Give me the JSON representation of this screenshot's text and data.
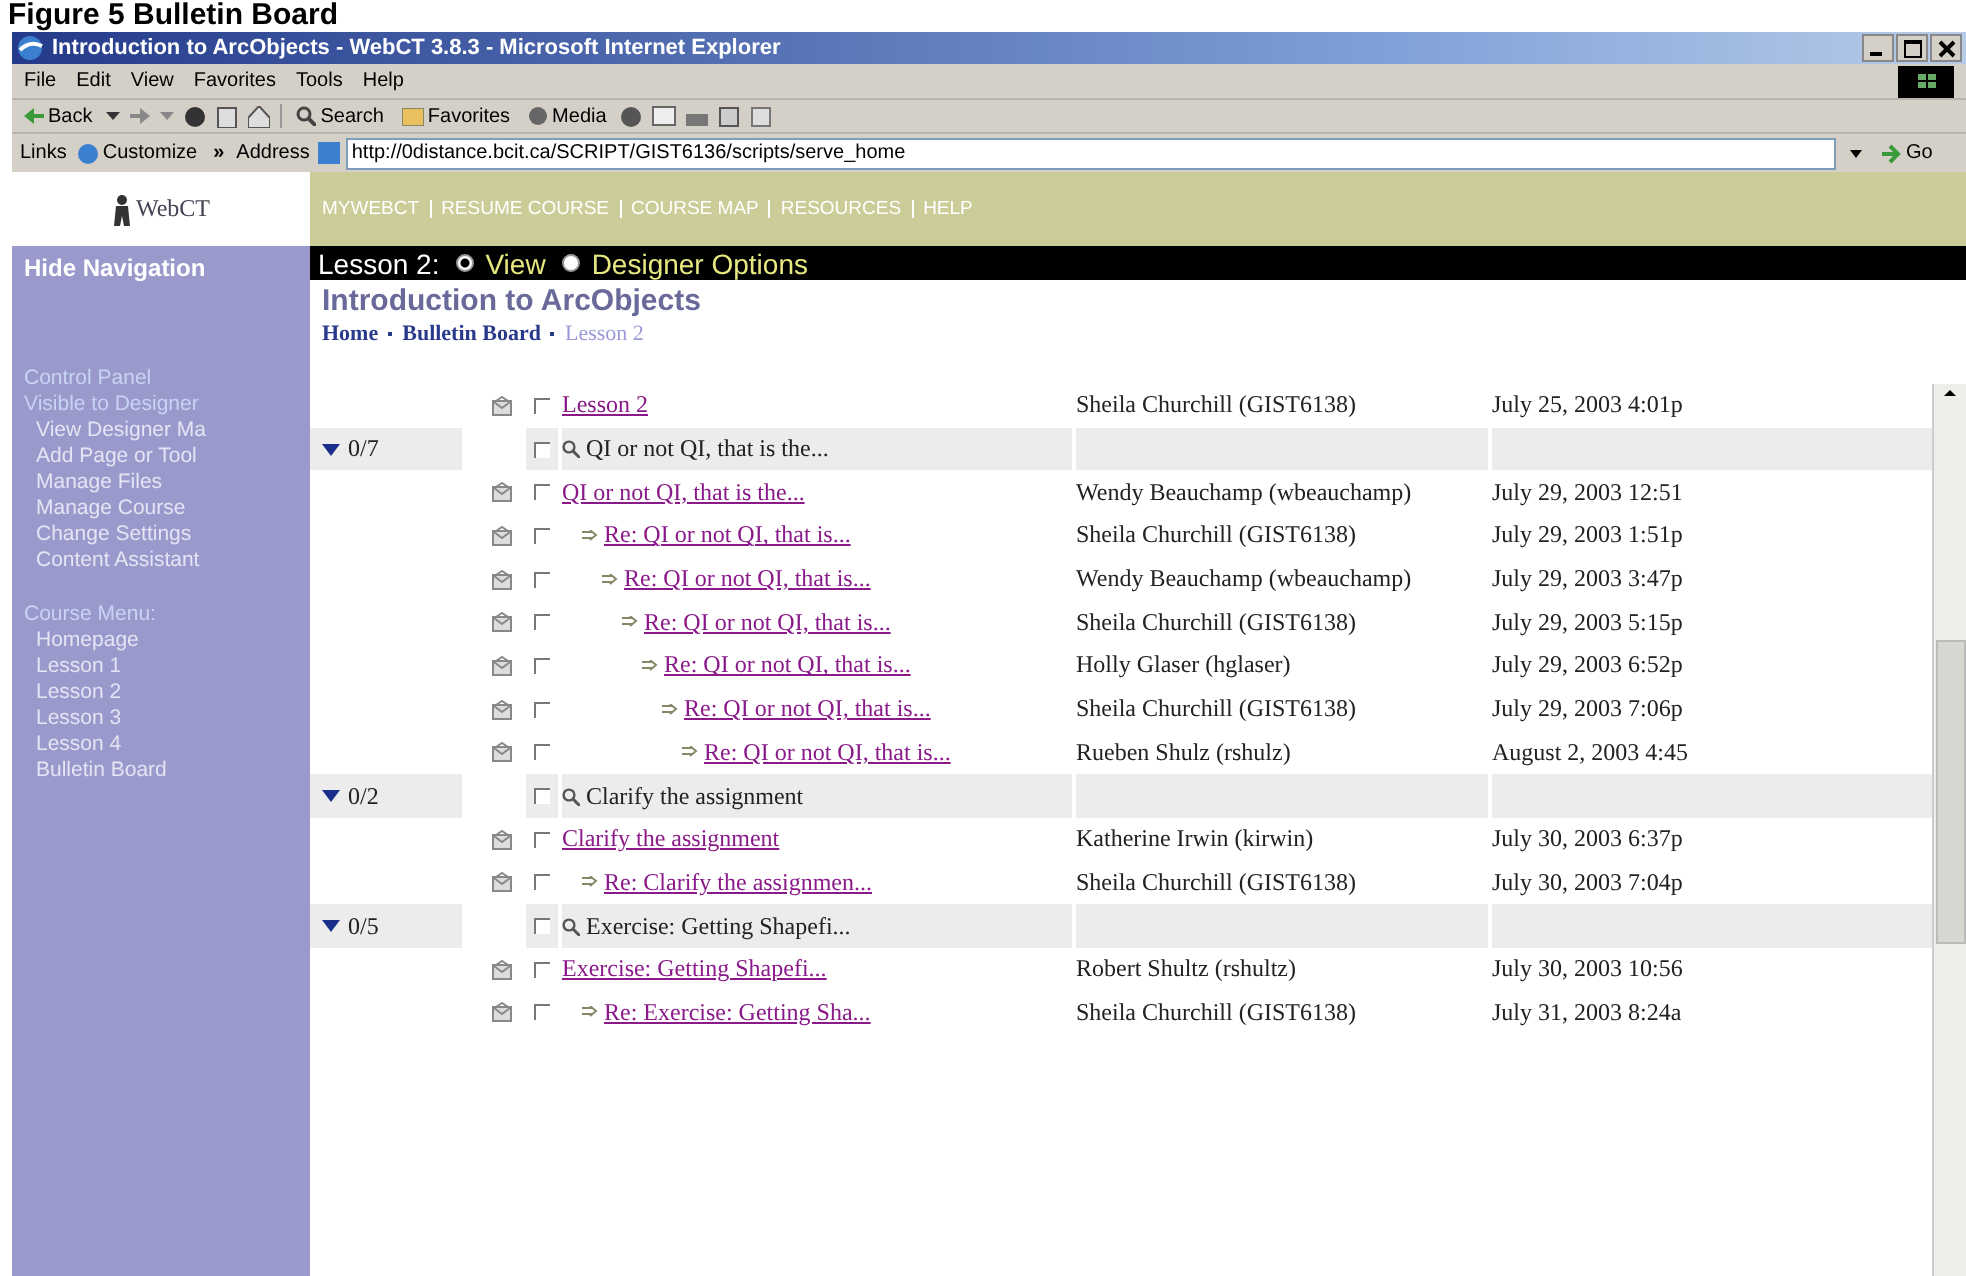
{
  "caption": "Figure 5 Bulletin Board",
  "window": {
    "title": "Introduction to ArcObjects - WebCT 3.8.3 - Microsoft Internet Explorer"
  },
  "menu": [
    "File",
    "Edit",
    "View",
    "Favorites",
    "Tools",
    "Help"
  ],
  "toolbar": {
    "back": "Back",
    "search": "Search",
    "favorites": "Favorites",
    "media": "Media"
  },
  "links": {
    "label": "Links",
    "customize": "Customize",
    "more": "»"
  },
  "address": {
    "label": "Address",
    "value": "http://0distance.bcit.ca/SCRIPT/GIST6136/scripts/serve_home",
    "go": "Go"
  },
  "logo": "WebCT",
  "top_nav": [
    "MYWEBCT",
    "RESUME COURSE",
    "COURSE MAP",
    "RESOURCES",
    "HELP"
  ],
  "sidebar": {
    "hide": "Hide Navigation",
    "sections": [
      {
        "headings": [
          "Control Panel",
          "Visible to Designer"
        ],
        "items": [
          "View Designer Ma",
          "Add Page or Tool",
          "Manage Files",
          "Manage Course",
          "Change Settings",
          "Content Assistant"
        ]
      },
      {
        "headings": [
          "Course Menu:"
        ],
        "items": [
          "Homepage",
          "Lesson 1",
          "Lesson 2",
          "Lesson 3",
          "Lesson 4",
          "Bulletin Board"
        ]
      }
    ]
  },
  "lesson_bar": {
    "label": "Lesson 2:",
    "options": [
      {
        "label": "View",
        "selected": true
      },
      {
        "label": "Designer Options",
        "selected": false
      }
    ]
  },
  "course_title": "Introduction to ArcObjects",
  "breadcrumb": [
    {
      "label": "Home",
      "current": false
    },
    {
      "label": "Bulletin Board",
      "current": false
    },
    {
      "label": "Lesson 2",
      "current": true
    }
  ],
  "posts": [
    {
      "kind": "message",
      "checked": false,
      "subject": "Lesson 2",
      "author": "Sheila Churchill (GIST6138)",
      "date": "July 25, 2003 4:01p"
    },
    {
      "kind": "thread",
      "checked": false,
      "count": "0/7",
      "subject": "QI or not QI, that is the...",
      "expanded": true,
      "children": [
        {
          "kind": "message",
          "checked": false,
          "subject": "QI or not QI, that is the...",
          "author": "Wendy Beauchamp (wbeauchamp)",
          "date": "July 29, 2003 12:51",
          "children": [
            {
              "kind": "message",
              "checked": false,
              "subject": "Re: QI or not QI, that is...",
              "author": "Sheila Churchill (GIST6138)",
              "date": "July 29, 2003 1:51p",
              "children": [
                {
                  "kind": "message",
                  "checked": false,
                  "subject": "Re: QI or not QI, that is...",
                  "author": "Wendy Beauchamp (wbeauchamp)",
                  "date": "July 29, 2003 3:47p",
                  "children": [
                    {
                      "kind": "message",
                      "checked": false,
                      "subject": "Re: QI or not QI, that is...",
                      "author": "Sheila Churchill (GIST6138)",
                      "date": "July 29, 2003 5:15p",
                      "children": [
                        {
                          "kind": "message",
                          "checked": false,
                          "subject": "Re: QI or not QI, that is...",
                          "author": "Holly Glaser (hglaser)",
                          "date": "July 29, 2003 6:52p",
                          "children": [
                            {
                              "kind": "message",
                              "checked": false,
                              "subject": "Re: QI or not QI, that is...",
                              "author": "Sheila Churchill (GIST6138)",
                              "date": "July 29, 2003 7:06p",
                              "children": [
                                {
                                  "kind": "message",
                                  "checked": false,
                                  "subject": "Re: QI or not QI, that is...",
                                  "author": "Rueben Shulz (rshulz)",
                                  "date": "August 2, 2003 4:45"
                                }
                              ]
                            }
                          ]
                        }
                      ]
                    }
                  ]
                }
              ]
            }
          ]
        }
      ]
    },
    {
      "kind": "thread",
      "checked": false,
      "count": "0/2",
      "subject": "Clarify the assignment",
      "expanded": true,
      "children": [
        {
          "kind": "message",
          "checked": false,
          "subject": "Clarify the assignment",
          "author": "Katherine Irwin (kirwin)",
          "date": "July 30, 2003 6:37p",
          "children": [
            {
              "kind": "message",
              "checked": false,
              "subject": "Re: Clarify the assignmen...",
              "author": "Sheila Churchill (GIST6138)",
              "date": "July 30, 2003 7:04p"
            }
          ]
        }
      ]
    },
    {
      "kind": "thread",
      "checked": false,
      "count": "0/5",
      "subject": "Exercise: Getting Shapefi...",
      "expanded": true,
      "children": [
        {
          "kind": "message",
          "checked": false,
          "subject": "Exercise: Getting Shapefi...",
          "author": "Robert Shultz (rshultz)",
          "date": "July 30, 2003 10:56",
          "children": [
            {
              "kind": "message",
              "checked": false,
              "subject": "Re: Exercise: Getting Sha...",
              "author": "Sheila Churchill (GIST6138)",
              "date": "July 31, 2003 8:24a"
            }
          ]
        }
      ]
    }
  ]
}
